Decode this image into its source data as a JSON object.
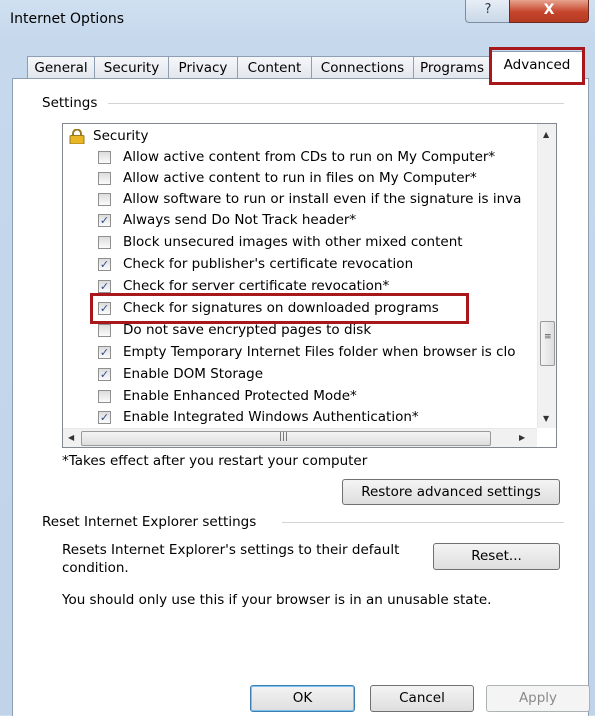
{
  "window": {
    "title": "Internet Options",
    "help_glyph": "?",
    "close_glyph": "X"
  },
  "tabs": [
    {
      "label": "General"
    },
    {
      "label": "Security"
    },
    {
      "label": "Privacy"
    },
    {
      "label": "Content"
    },
    {
      "label": "Connections"
    },
    {
      "label": "Programs"
    },
    {
      "label": "Advanced"
    }
  ],
  "active_tab": "Advanced",
  "settings": {
    "group_label": "Settings",
    "section_label": "Security",
    "items": [
      {
        "label": "Allow active content from CDs to run on My Computer*",
        "checked": false
      },
      {
        "label": "Allow active content to run in files on My Computer*",
        "checked": false
      },
      {
        "label": "Allow software to run or install even if the signature is inva",
        "checked": false
      },
      {
        "label": "Always send Do Not Track header*",
        "checked": true
      },
      {
        "label": "Block unsecured images with other mixed content",
        "checked": false
      },
      {
        "label": "Check for publisher's certificate revocation",
        "checked": true
      },
      {
        "label": "Check for server certificate revocation*",
        "checked": true
      },
      {
        "label": "Check for signatures on downloaded programs",
        "checked": true
      },
      {
        "label": "Do not save encrypted pages to disk",
        "checked": false
      },
      {
        "label": "Empty Temporary Internet Files folder when browser is clo",
        "checked": true
      },
      {
        "label": "Enable DOM Storage",
        "checked": true
      },
      {
        "label": "Enable Enhanced Protected Mode*",
        "checked": false
      },
      {
        "label": "Enable Integrated Windows Authentication*",
        "checked": true
      }
    ],
    "footnote": "*Takes effect after you restart your computer",
    "restore_button": "Restore advanced settings"
  },
  "reset": {
    "group_label": "Reset Internet Explorer settings",
    "description_line1": "Resets Internet Explorer's settings to their default",
    "description_line2": "condition.",
    "button": "Reset...",
    "warning": "You should only use this if your browser is in an unusable state."
  },
  "footer": {
    "ok": "OK",
    "cancel": "Cancel",
    "apply": "Apply"
  },
  "colors": {
    "highlight": "#a8171c",
    "close_button": "#c6442b",
    "title_bar": "#c6d8ec"
  }
}
